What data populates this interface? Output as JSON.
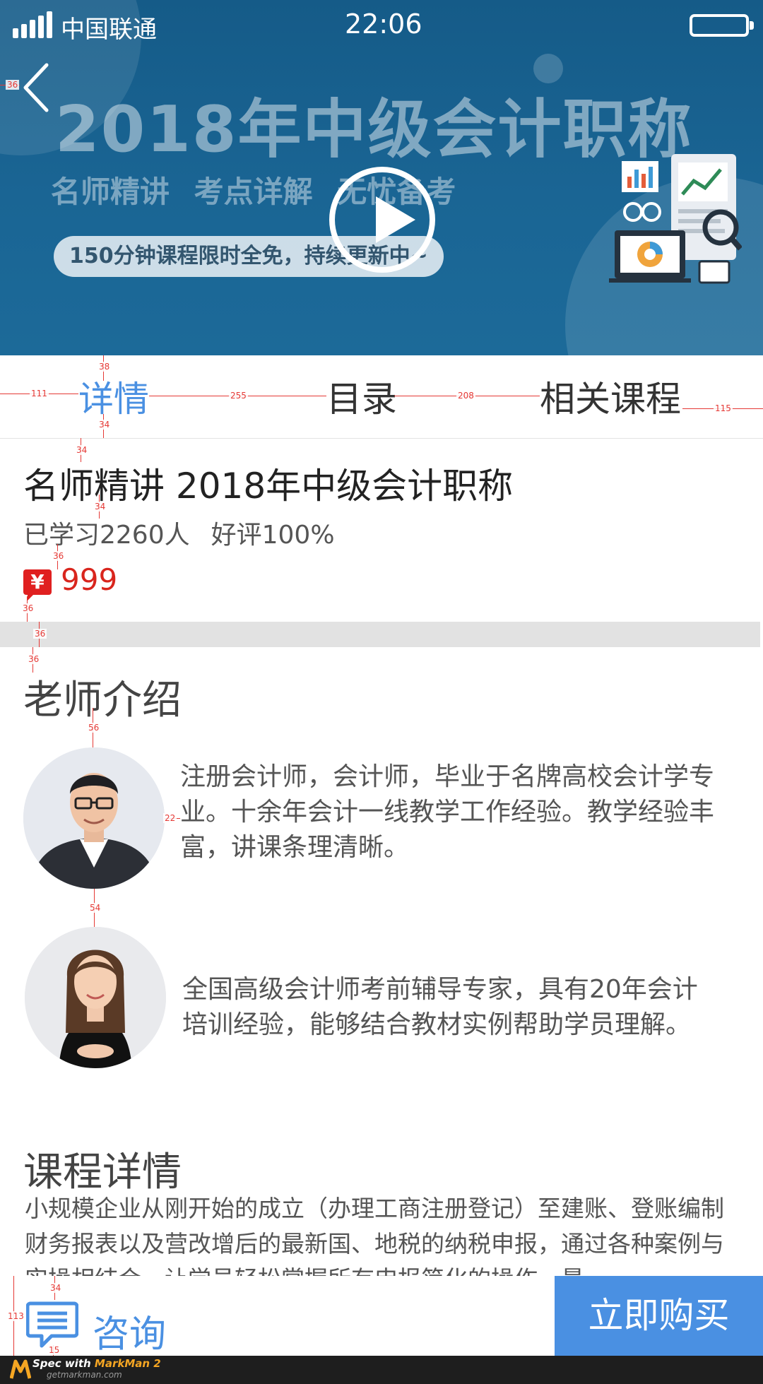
{
  "status_bar": {
    "carrier": "中国联通",
    "time": "22:06"
  },
  "banner": {
    "title": "2018年中级会计职称",
    "subtitle": "名师精讲   考点详解   无忧备考",
    "promo": "150分钟课程限时全免，持续更新中~"
  },
  "tabs": [
    {
      "label": "详情",
      "active": true
    },
    {
      "label": "目录",
      "active": false
    },
    {
      "label": "相关课程",
      "active": false
    }
  ],
  "course": {
    "title": "名师精讲 2018年中级会计职称",
    "learners": "已学习2260人",
    "rating": "好评100%",
    "currency_symbol": "¥",
    "price": "999"
  },
  "teachers": {
    "title": "老师介绍",
    "items": [
      {
        "description": "注册会计师，会计师，毕业于名牌高校会计学专业。十余年会计一线教学工作经验。教学经验丰富，讲课条理清晰。"
      },
      {
        "description": "全国高级会计师考前辅导专家，具有20年会计培训经验，能够结合教材实例帮助学员理解。"
      }
    ]
  },
  "course_detail": {
    "title": "课程详情",
    "text": "小规模企业从刚开始的成立（办理工商注册登记）至建账、登账编制财务报表以及营改增后的最新国、地税的纳税申报，通过各种案例与实操相结合，让学员轻松掌握所有申报简化的操作，最"
  },
  "bottom_bar": {
    "consult_label": "咨询",
    "buy_label": "立即购买"
  },
  "footer": {
    "brand_prefix": "Spec with ",
    "brand": "MarkMan 2",
    "site": "getmarkman.com"
  },
  "spec_marks": {
    "back_gap": "36",
    "tab_top": "38",
    "tab_left": "111",
    "tab_gap_1": "255",
    "tab_gap_2": "208",
    "tab_right": "115",
    "tab_bottom": "34",
    "title_top": "34",
    "stats_top": "34",
    "price_top": "36",
    "divider_top": "36",
    "divider_height": "36",
    "section_top": "36",
    "avatar_top": "56",
    "avatar_text_gap": "22",
    "avatar_gap": "54",
    "bar_height": "113",
    "icon_top": "34",
    "icon_bottom": "15"
  },
  "colors": {
    "accent": "#4a90e2",
    "price": "#d9251d",
    "banner": "#175f8d",
    "spec": "#e53935"
  }
}
